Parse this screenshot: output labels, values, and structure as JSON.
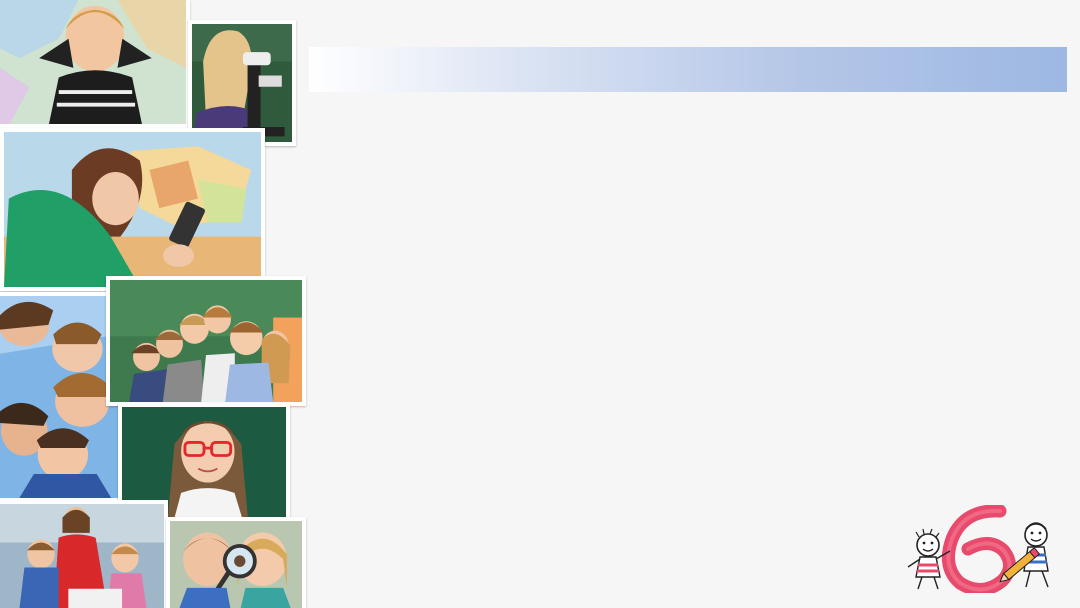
{
  "slide": {
    "title": "",
    "photos": [
      {
        "name": "boy-hands-behind-head-photo"
      },
      {
        "name": "girl-microscope-photo"
      },
      {
        "name": "girl-tablet-map-photo"
      },
      {
        "name": "kids-looking-down-photo"
      },
      {
        "name": "kids-at-chalkboard-photo"
      },
      {
        "name": "girl-red-glasses-photo"
      },
      {
        "name": "teacher-with-kids-photo"
      },
      {
        "name": "kids-magnifying-glass-photo"
      }
    ],
    "logo": {
      "icon": "kids-with-pencil-six-logo",
      "accent": "#e84a6b"
    }
  },
  "colors": {
    "background": "#f6f6f6",
    "title_bar_start": "#ffffff",
    "title_bar_end": "#9db8e3"
  }
}
